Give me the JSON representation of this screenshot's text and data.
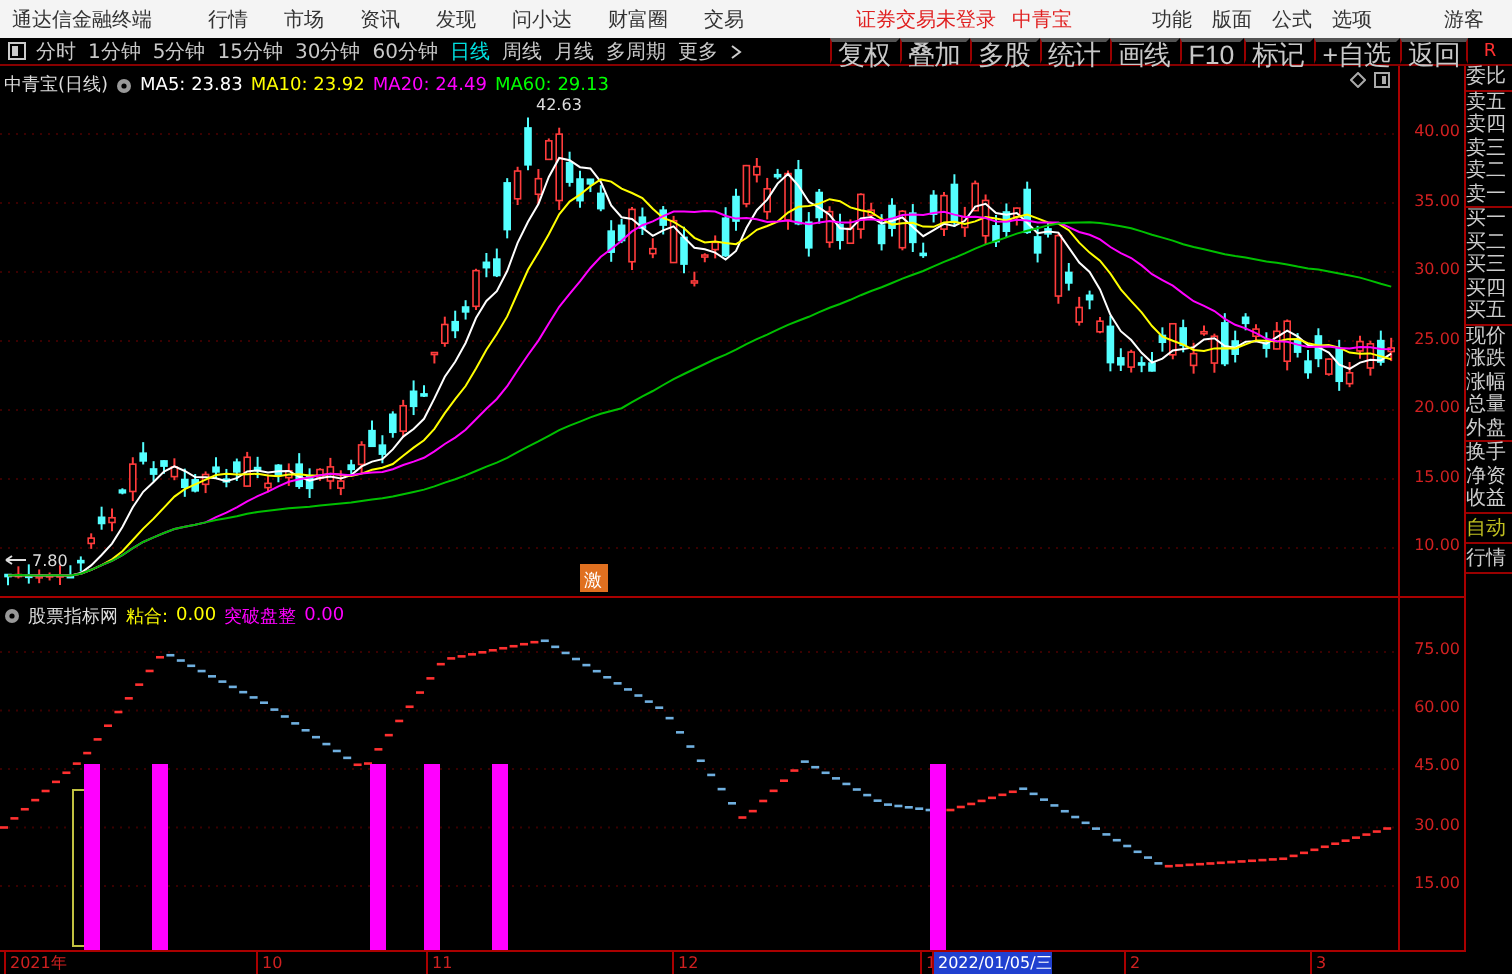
{
  "menu_bar": {
    "app_title": "通达信金融终端",
    "menus": [
      "行情",
      "市场",
      "资讯",
      "发现",
      "问小达",
      "财富圈",
      "交易"
    ],
    "login_status": "证券交易未登录",
    "stock_name": "中青宝",
    "right_menus": [
      "功能",
      "版面",
      "公式",
      "选项"
    ],
    "user": "游客"
  },
  "period_tabs": [
    {
      "label": "分时",
      "selected": false
    },
    {
      "label": "1分钟",
      "selected": false
    },
    {
      "label": "5分钟",
      "selected": false
    },
    {
      "label": "15分钟",
      "selected": false
    },
    {
      "label": "30分钟",
      "selected": false
    },
    {
      "label": "60分钟",
      "selected": false
    },
    {
      "label": "日线",
      "selected": true
    },
    {
      "label": "周线",
      "selected": false
    },
    {
      "label": "月线",
      "selected": false
    },
    {
      "label": "多周期",
      "selected": false
    },
    {
      "label": "更多",
      "selected": false
    }
  ],
  "tools": [
    "复权",
    "叠加",
    "多股",
    "统计",
    "画线",
    "F10",
    "标记",
    "+自选",
    "返回"
  ],
  "corner_label": "R",
  "main_chart": {
    "title": "中青宝(日线)",
    "ma": [
      {
        "label": "MA5: 23.83",
        "color": "#ffffff"
      },
      {
        "label": "MA10: 23.92",
        "color": "#ffff00"
      },
      {
        "label": "MA20: 24.49",
        "color": "#ff00ff"
      },
      {
        "label": "MA60: 29.13",
        "color": "#00ff00"
      }
    ],
    "high_label": "42.63",
    "low_label": "7.80",
    "signal_label": "激",
    "price_ticks": [
      "40.00",
      "35.00",
      "30.00",
      "25.00",
      "20.00",
      "15.00",
      "10.00"
    ]
  },
  "indicator": {
    "source": "股票指标网",
    "values": [
      {
        "name": "粘合:",
        "value": "0.00",
        "color": "#ffff00"
      },
      {
        "name": "突破盘整",
        "value": "0.00",
        "color": "#ff00ff"
      }
    ],
    "ticks": [
      "75.00",
      "60.00",
      "45.00",
      "30.00",
      "15.00"
    ]
  },
  "date_axis": [
    {
      "label": "2021年",
      "selected": false
    },
    {
      "label": "10",
      "selected": false
    },
    {
      "label": "11",
      "selected": false
    },
    {
      "label": "12",
      "selected": false
    },
    {
      "label": "1",
      "selected": false
    },
    {
      "label": "2022/01/05/三",
      "selected": true
    },
    {
      "label": "2",
      "selected": false
    },
    {
      "label": "3",
      "selected": false
    }
  ],
  "quote_panel": {
    "groups": [
      [
        "委比"
      ],
      [
        "卖五",
        "卖四",
        "卖三",
        "卖二",
        "卖一"
      ],
      [
        "买一",
        "买二",
        "买三",
        "买四",
        "买五"
      ],
      [
        "现价",
        "涨跌",
        "涨幅",
        "总量",
        "外盘"
      ],
      [
        "换手",
        "净资",
        "收益"
      ]
    ],
    "buttons": [
      "自动",
      "行情"
    ]
  }
}
